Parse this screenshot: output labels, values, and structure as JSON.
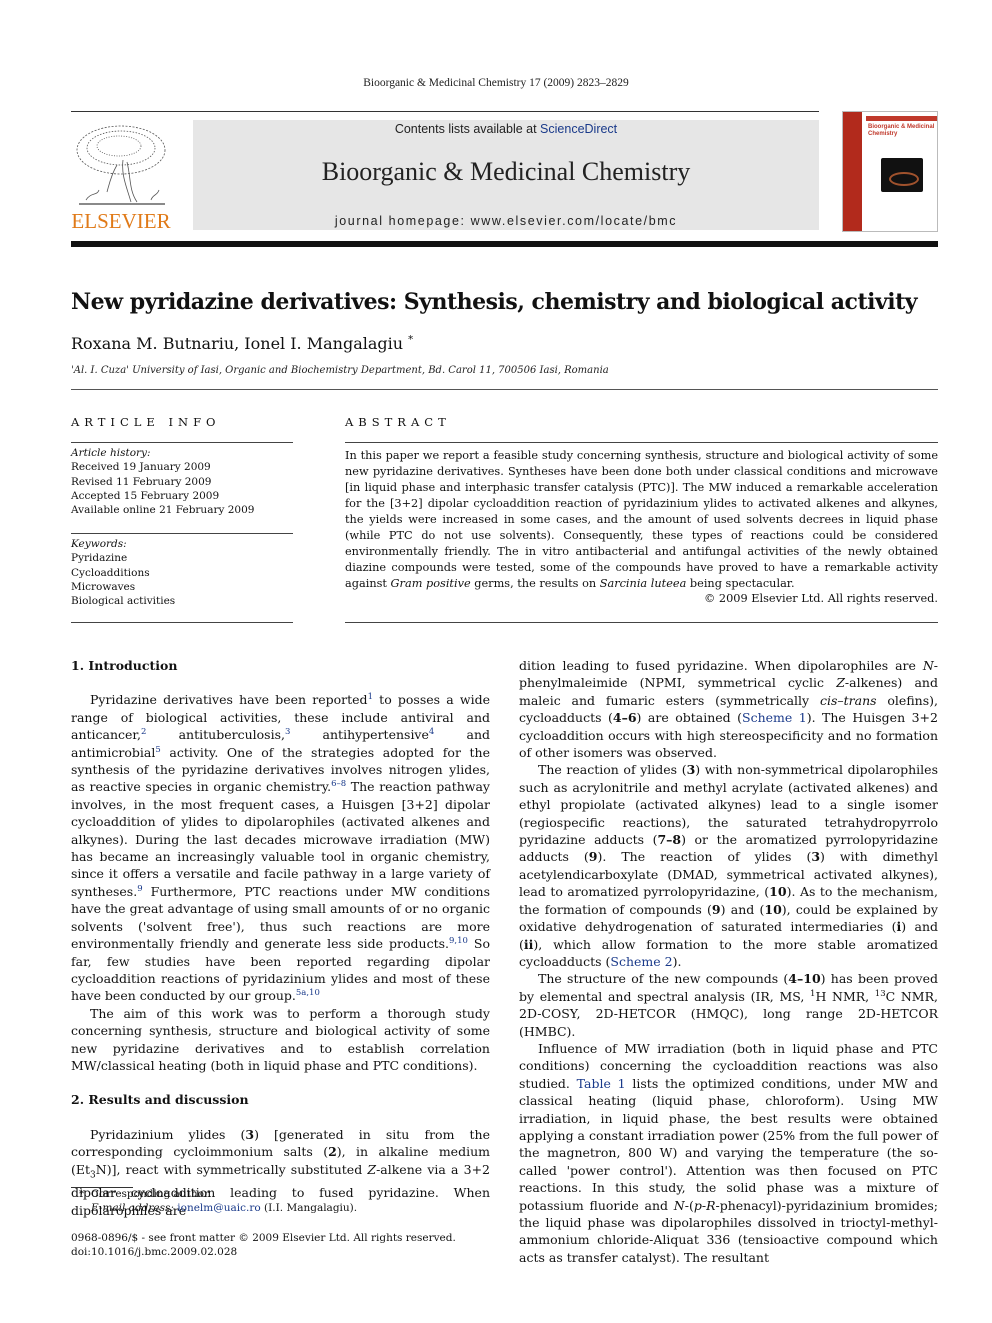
{
  "header": {
    "running_head": "Bioorganic & Medicinal Chemistry 17 (2009) 2823–2829",
    "publisher_logo_text": "ELSEVIER",
    "contents_prefix": "Contents lists available at ",
    "contents_link": "ScienceDirect",
    "journal_title": "Bioorganic & Medicinal Chemistry",
    "homepage": "journal homepage: www.elsevier.com/locate/bmc",
    "cover_title": "Bioorganic & Medicinal Chemistry",
    "colors": {
      "logo": "#e07a18",
      "link": "#1a3a8a",
      "banner": "#e6e6e6",
      "cover_accent": "#b22a1c"
    }
  },
  "article": {
    "title": "New pyridazine derivatives: Synthesis, chemistry and biological activity",
    "authors": "Roxana M. Butnariu, Ionel I. Mangalagiu",
    "author_mark": "*",
    "affiliation": "'Al. I. Cuza' University of Iasi, Organic and Biochemistry Department, Bd. Carol 11, 700506 Iasi, Romania"
  },
  "article_info": {
    "heading": "ARTICLE INFO",
    "history_label": "Article history:",
    "history": [
      "Received 19 January 2009",
      "Revised 11 February 2009",
      "Accepted 15 February 2009",
      "Available online 21 February 2009"
    ],
    "keywords_label": "Keywords:",
    "keywords": [
      "Pyridazine",
      "Cycloadditions",
      "Microwaves",
      "Biological activities"
    ]
  },
  "abstract": {
    "heading": "ABSTRACT",
    "text_1": "In this paper we report a feasible study concerning synthesis, structure and biological activity of some new pyridazine derivatives. Syntheses have been done both under classical conditions and microwave [in liquid phase and interphasic transfer catalysis (PTC)]. The MW induced a remarkable acceleration for the [3+2] dipolar cycloaddition reaction of pyridazinium ylides to activated alkenes and alkynes, the yields were increased in some cases, and the amount of used solvents decrees in liquid phase (while PTC do not use solvents). Consequently, these types of reactions could be considered environmentally friendly. The in vitro antibacterial and antifungal activities of the newly obtained diazine compounds were tested, some of the compounds have proved to have a remarkable activity against ",
    "italic_1": "Gram positive",
    "text_2": " germs, the results on ",
    "italic_2": "Sarcinia luteea",
    "text_3": " being spectacular.",
    "copyright": "© 2009 Elsevier Ltd. All rights reserved."
  },
  "body": {
    "sec1_heading": "1. Introduction",
    "p1": {
      "a": "Pyridazine derivatives have been reported",
      "r1": "1",
      "b": " to posses a wide range of biological activities, these include antiviral and anticancer,",
      "r2": "2",
      "c": " antituberculosis,",
      "r3": "3",
      "d": " antihypertensive",
      "r4": "4",
      "e": " and antimicrobial",
      "r5": "5",
      "f": " activity. One of the strategies adopted for the synthesis of the pyridazine derivatives involves nitrogen ylides, as reactive species in organic chemistry.",
      "r6": "6–8",
      "g": " The reaction pathway involves, in the most frequent cases, a Huisgen [3+2] dipolar cycloaddition of ylides to dipolarophiles (activated alkenes and alkynes). During the last decades microwave irradiation (MW) has became an increasingly valuable tool in organic chemistry, since it offers a versatile and facile pathway in a large variety of syntheses.",
      "r7": "9",
      "h": " Furthermore, PTC reactions under MW conditions have the great advantage of using small amounts of or no organic solvents ('solvent free'), thus such reactions are more environmentally friendly and generate less side products.",
      "r8": "9,10",
      "i": " So far, few studies have been reported regarding dipolar cycloaddition reactions of pyridazinium ylides and most of these have been conducted by our group.",
      "r9": "5a,10"
    },
    "p2": "The aim of this work was to perform a thorough study concerning synthesis, structure and biological activity of some new pyridazine derivatives and to establish correlation MW/classical heating (both in liquid phase and PTC conditions).",
    "sec2_heading": "2. Results and discussion",
    "p3": {
      "a": "Pyridazinium ylides (",
      "b1": "3",
      "b": ") [generated in situ from the corresponding cycloimmonium salts (",
      "b2": "2",
      "c": "), in alkaline medium (Et",
      "sub": "3",
      "d": "N)], react with symmetrically substituted ",
      "i1": "Z",
      "e": "-alkene via a 3+2 dipolar cycloaddition leading to fused pyridazine. When dipolarophiles are ",
      "i2": "N",
      "f": "-phenylmaleimide (NPMI, symmetrical cyclic ",
      "i3": "Z",
      "g": "-alkenes) and maleic and fumaric esters (symmetrically ",
      "i4": "cis–trans",
      "h": " olefins), cycloadducts (",
      "b3": "4–6",
      "j": ") are obtained (",
      "link": "Scheme 1",
      "k": "). The Huisgen 3+2 cycloaddition occurs with high stereospecificity and no formation of other isomers was observed."
    },
    "p4": {
      "a": "The reaction of ylides (",
      "b1": "3",
      "b": ") with non-symmetrical dipolarophiles such as acrylonitrile and methyl acrylate (activated alkenes) and ethyl propiolate (activated alkynes) lead to a single isomer (regiospecific reactions), the saturated tetrahydropyrrolo pyridazine adducts (",
      "b2": "7–8",
      "c": ") or the aromatized pyrrolopyridazine adducts (",
      "b3": "9",
      "d": "). The reaction of ylides (",
      "b4": "3",
      "e": ") with dimethyl acetylendicarboxylate (DMAD, symmetrical activated alkynes), lead to aromatized pyrrolopyridazine, (",
      "b5": "10",
      "f": "). As to the mechanism, the formation of compounds (",
      "b6": "9",
      "g": ") and (",
      "b7": "10",
      "h": "), could be explained by oxidative dehydrogenation of saturated intermediaries (",
      "b8": "i",
      "j": ") and (",
      "b9": "ii",
      "k": "), which allow formation to the more stable aromatized cycloadducts (",
      "link": "Scheme 2",
      "l": ")."
    },
    "p5": {
      "a": "The structure of the new compounds (",
      "b1": "4–10",
      "b": ") has been proved by elemental and spectral analysis (IR, MS, ",
      "s1": "1",
      "c": "H NMR, ",
      "s2": "13",
      "d": "C NMR, 2D-COSY, 2D-HETCOR (HMQC), long range 2D-HETCOR (HMBC)."
    },
    "p6": {
      "a": "Influence of MW irradiation (both in liquid phase and PTC conditions) concerning the cycloaddition reactions was also studied. ",
      "link": "Table 1",
      "b": " lists the optimized conditions, under MW and classical heating (liquid phase, chloroform). Using MW irradiation, in liquid phase, the best results were obtained applying a constant irradiation power (25% from the full power of the magnetron, 800 W) and varying the temperature (the so-called 'power control'). Attention was then focused on PTC reactions. In this study, the solid phase was a mixture of potassium fluoride and ",
      "i1": "N",
      "c": "-(",
      "i2": "p",
      "d": "-",
      "i3": "R",
      "e": "-phenacyl)-pyridazinium bromides; the liquid phase was dipolarophiles dissolved in trioctyl-methyl-ammonium chloride-Aliquat 336 (tensioactive compound which acts as transfer catalyst). The resultant"
    }
  },
  "footer": {
    "fn_mark": "*",
    "fn_corresponding": "Corresponding author.",
    "fn_email_label": "E-mail address:",
    "fn_email": "ionelm@uaic.ro",
    "fn_email_suffix": " (I.I. Mangalagiu).",
    "issn_line": "0968-0896/$ - see front matter © 2009 Elsevier Ltd. All rights reserved.",
    "doi": "doi:10.1016/j.bmc.2009.02.028"
  }
}
